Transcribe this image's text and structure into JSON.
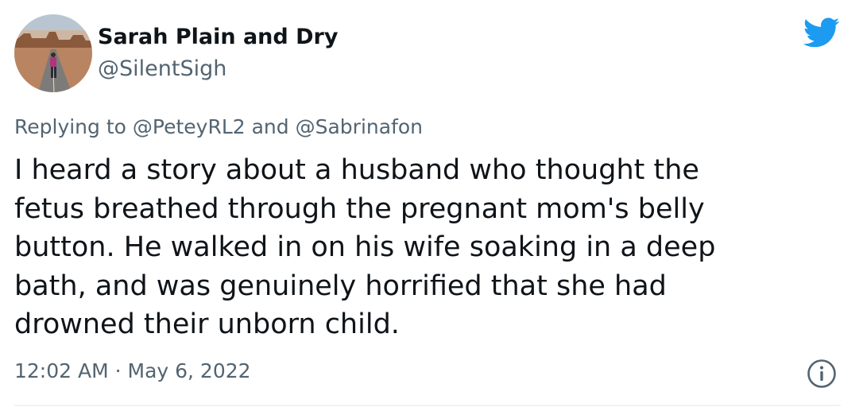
{
  "author": {
    "display_name": "Sarah Plain and Dry",
    "handle": "@SilentSigh",
    "avatar_icon": "avatar-photo"
  },
  "reply": {
    "prefix": "Replying to",
    "mention_1": "@PeteyRL2",
    "joiner": "and",
    "mention_2": "@Sabrinafon"
  },
  "tweet": {
    "lines": [
      "I heard a story about a husband who thought the",
      "fetus breathed through the pregnant mom's belly",
      "button. He walked in on his wife soaking in a deep",
      "bath, and was genuinely horrified that she had",
      "drowned their unborn child."
    ]
  },
  "meta": {
    "timestamp": "12:02 AM · May 6, 2022"
  },
  "icons": {
    "brand": "twitter-bird-icon",
    "info": "info-icon"
  },
  "colors": {
    "brand_blue": "#1d9bf0",
    "text_primary": "#0f1419",
    "text_secondary": "#536471",
    "divider": "#eff3f4"
  }
}
